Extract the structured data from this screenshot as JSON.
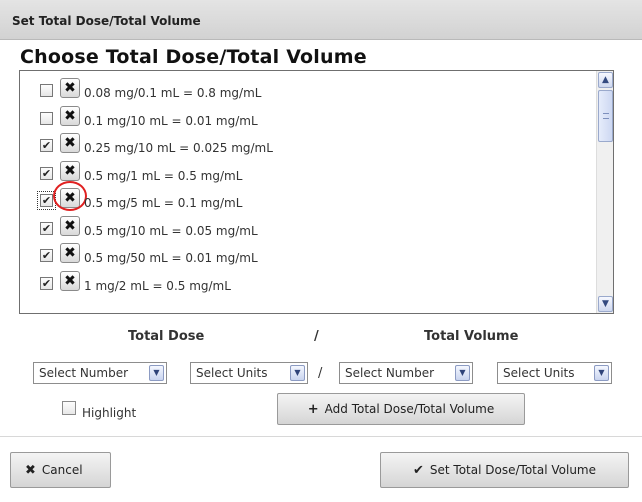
{
  "window": {
    "title": "Set Total Dose/Total Volume"
  },
  "dialog": {
    "heading": "Choose Total Dose/Total Volume"
  },
  "options": [
    {
      "label": "0.08 mg/0.1 mL = 0.8 mg/mL",
      "checked": false
    },
    {
      "label": "0.1 mg/10 mL = 0.01 mg/mL",
      "checked": false
    },
    {
      "label": "0.25 mg/10 mL = 0.025 mg/mL",
      "checked": true
    },
    {
      "label": "0.5 mg/1 mL = 0.5 mg/mL",
      "checked": true
    },
    {
      "label": "0.5 mg/5 mL = 0.1 mg/mL",
      "checked": true,
      "highlighted_delete": true
    },
    {
      "label": "0.5 mg/10 mL = 0.05 mg/mL",
      "checked": true
    },
    {
      "label": "0.5 mg/50 mL = 0.01 mg/mL",
      "checked": true
    },
    {
      "label": "1 mg/2 mL = 0.5 mg/mL",
      "checked": true
    }
  ],
  "icons": {
    "checked": "✔",
    "delete": "✖"
  },
  "columns": {
    "dose": "Total Dose",
    "separator": "/",
    "volume": "Total Volume"
  },
  "selects": {
    "dose_number": "Select Number",
    "dose_units": "Select Units",
    "volume_number": "Select Number",
    "volume_units": "Select Units"
  },
  "highlight": {
    "label": "Highlight",
    "checked": false
  },
  "buttons": {
    "add": "Add Total Dose/Total Volume",
    "cancel": "Cancel",
    "set": "Set Total Dose/Total Volume"
  },
  "colors": {
    "accent_circle": "#e02020"
  }
}
